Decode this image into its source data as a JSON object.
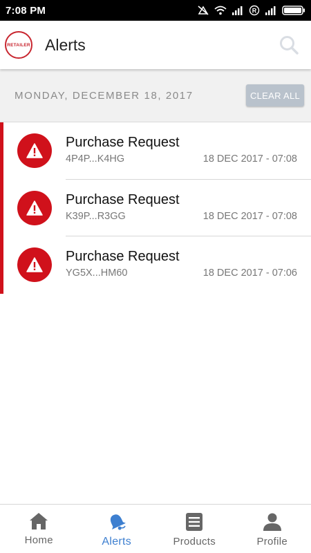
{
  "status_bar": {
    "time": "7:08 PM",
    "icons": [
      "do-not-disturb-icon",
      "wifi-icon",
      "signal-icon",
      "roaming-icon",
      "signal-icon",
      "battery-icon"
    ]
  },
  "app_bar": {
    "logo_text": "RETAILER",
    "title": "Alerts",
    "search_icon": "search-icon"
  },
  "date_header": {
    "date": "MONDAY, DECEMBER 18, 2017",
    "clear_all_label": "CLEAR ALL"
  },
  "alerts": [
    {
      "title": "Purchase Request",
      "id": "4P4P...K4HG",
      "timestamp": "18 DEC 2017 - 07:08",
      "icon": "warning-icon"
    },
    {
      "title": "Purchase Request",
      "id": "K39P...R3GG",
      "timestamp": "18 DEC 2017 - 07:08",
      "icon": "warning-icon"
    },
    {
      "title": "Purchase Request",
      "id": "YG5X...HM60",
      "timestamp": "18 DEC 2017 - 07:06",
      "icon": "warning-icon"
    }
  ],
  "bottom_nav": {
    "items": [
      {
        "label": "Home",
        "icon": "home-icon",
        "active": false
      },
      {
        "label": "Alerts",
        "icon": "bell-icon",
        "active": true
      },
      {
        "label": "Products",
        "icon": "list-icon",
        "active": false
      },
      {
        "label": "Profile",
        "icon": "person-icon",
        "active": false
      }
    ]
  },
  "colors": {
    "accent_red": "#d0111b",
    "active_blue": "#3d7fd0",
    "inactive_gray": "#666666",
    "clear_button_bg": "#b9c2cc"
  }
}
